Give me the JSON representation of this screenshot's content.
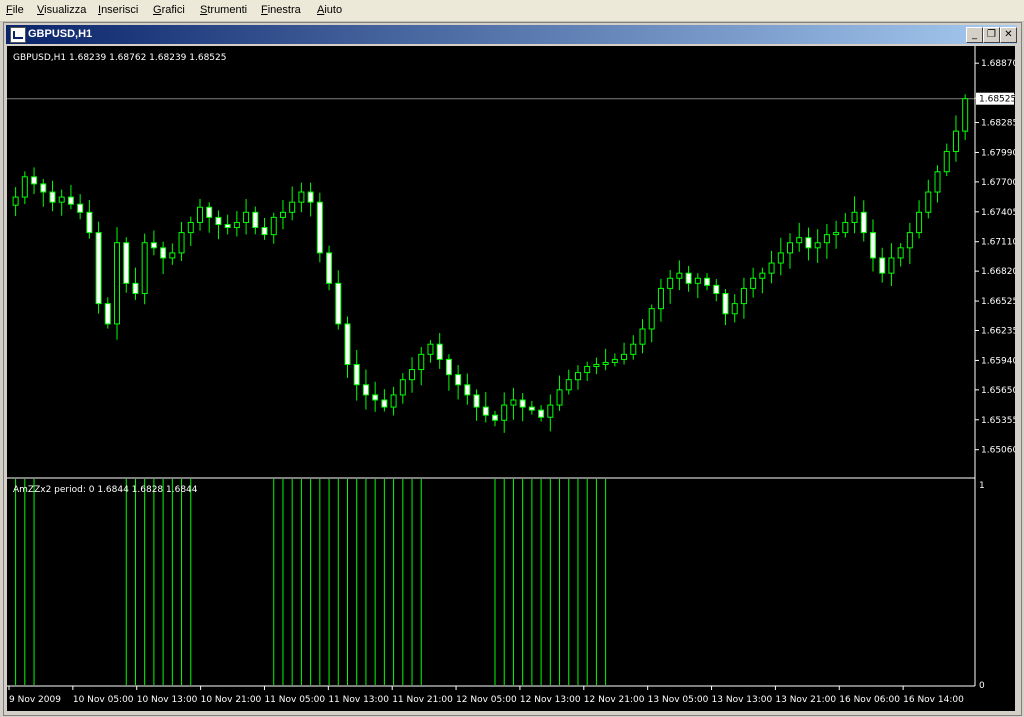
{
  "menu": {
    "items": [
      "File",
      "Visualizza",
      "Inserisci",
      "Grafici",
      "Strumenti",
      "Finestra",
      "Aiuto"
    ]
  },
  "window": {
    "title": "GBPUSD,H1",
    "minimize_label": "_",
    "restore_label": "❐",
    "close_label": "✕"
  },
  "chart": {
    "info": "GBPUSD,H1  1.68239 1.68762 1.68239 1.68525",
    "current_price": "1.68525",
    "indicator_label": "AmZZx2 period: 0 1.6844 1.6828 1.6844",
    "indicator_max_label": "1",
    "indicator_min_label": "0",
    "colors": {
      "background": "#000000",
      "candle": "#00ff00",
      "bull_body": "#000000",
      "bear_body": "#ffffff",
      "axis": "#ffffff",
      "price_line": "#808080"
    }
  },
  "chart_data": {
    "type": "candlestick",
    "symbol": "GBPUSD",
    "timeframe": "H1",
    "ylim": [
      1.6485,
      1.69
    ],
    "y_ticks": [
      "1.68870",
      "1.68525",
      "1.68285",
      "1.67990",
      "1.67700",
      "1.67405",
      "1.67110",
      "1.66820",
      "1.66525",
      "1.66235",
      "1.65940",
      "1.65650",
      "1.65355",
      "1.65060"
    ],
    "x_ticks": [
      "9 Nov 2009",
      "10 Nov 05:00",
      "10 Nov 13:00",
      "10 Nov 21:00",
      "11 Nov 05:00",
      "11 Nov 13:00",
      "11 Nov 21:00",
      "12 Nov 05:00",
      "12 Nov 13:00",
      "12 Nov 21:00",
      "13 Nov 05:00",
      "13 Nov 13:00",
      "13 Nov 21:00",
      "16 Nov 06:00",
      "16 Nov 14:00"
    ],
    "close_path": [
      1.6755,
      1.6775,
      1.6768,
      1.676,
      1.675,
      1.6755,
      1.6748,
      1.674,
      1.672,
      1.665,
      1.663,
      1.671,
      1.667,
      1.666,
      1.671,
      1.6705,
      1.6695,
      1.67,
      1.672,
      1.673,
      1.6745,
      1.6735,
      1.6728,
      1.6725,
      1.673,
      1.674,
      1.6725,
      1.6718,
      1.6735,
      1.674,
      1.675,
      1.676,
      1.675,
      1.67,
      1.667,
      1.663,
      1.659,
      1.657,
      1.656,
      1.6555,
      1.6548,
      1.656,
      1.6575,
      1.6585,
      1.66,
      1.661,
      1.6595,
      1.658,
      1.657,
      1.656,
      1.6548,
      1.654,
      1.6535,
      1.655,
      1.6555,
      1.6548,
      1.6545,
      1.6538,
      1.655,
      1.6565,
      1.6575,
      1.6582,
      1.6588,
      1.659,
      1.6592,
      1.6595,
      1.66,
      1.661,
      1.6625,
      1.6645,
      1.6665,
      1.6675,
      1.668,
      1.667,
      1.6675,
      1.6668,
      1.666,
      1.664,
      1.665,
      1.6665,
      1.6675,
      1.668,
      1.669,
      1.67,
      1.671,
      1.6715,
      1.6705,
      1.671,
      1.6718,
      1.672,
      1.673,
      1.674,
      1.672,
      1.6695,
      1.668,
      1.6695,
      1.6705,
      1.672,
      1.674,
      1.676,
      1.678,
      1.68,
      1.682,
      1.6852
    ],
    "indicator": {
      "type": "histogram",
      "ylim": [
        0,
        1
      ],
      "values": [
        1,
        1,
        1,
        0,
        0,
        0,
        0,
        0,
        0,
        0,
        0,
        0,
        1,
        1,
        1,
        1,
        1,
        1,
        1,
        1,
        0,
        0,
        0,
        0,
        0,
        0,
        0,
        0,
        1,
        1,
        1,
        1,
        1,
        1,
        1,
        1,
        1,
        1,
        1,
        1,
        1,
        1,
        1,
        1,
        1,
        0,
        0,
        0,
        0,
        0,
        0,
        0,
        1,
        1,
        1,
        1,
        1,
        1,
        1,
        1,
        1,
        1,
        1,
        1,
        1,
        0,
        0,
        0,
        0,
        0,
        0,
        0,
        0,
        0,
        0,
        0,
        0,
        0,
        0,
        0,
        0,
        0,
        0,
        0,
        0,
        0,
        0,
        0,
        0,
        0,
        0,
        0,
        0,
        0,
        0,
        0,
        0,
        0,
        0,
        0,
        0,
        0,
        0,
        0
      ]
    }
  }
}
